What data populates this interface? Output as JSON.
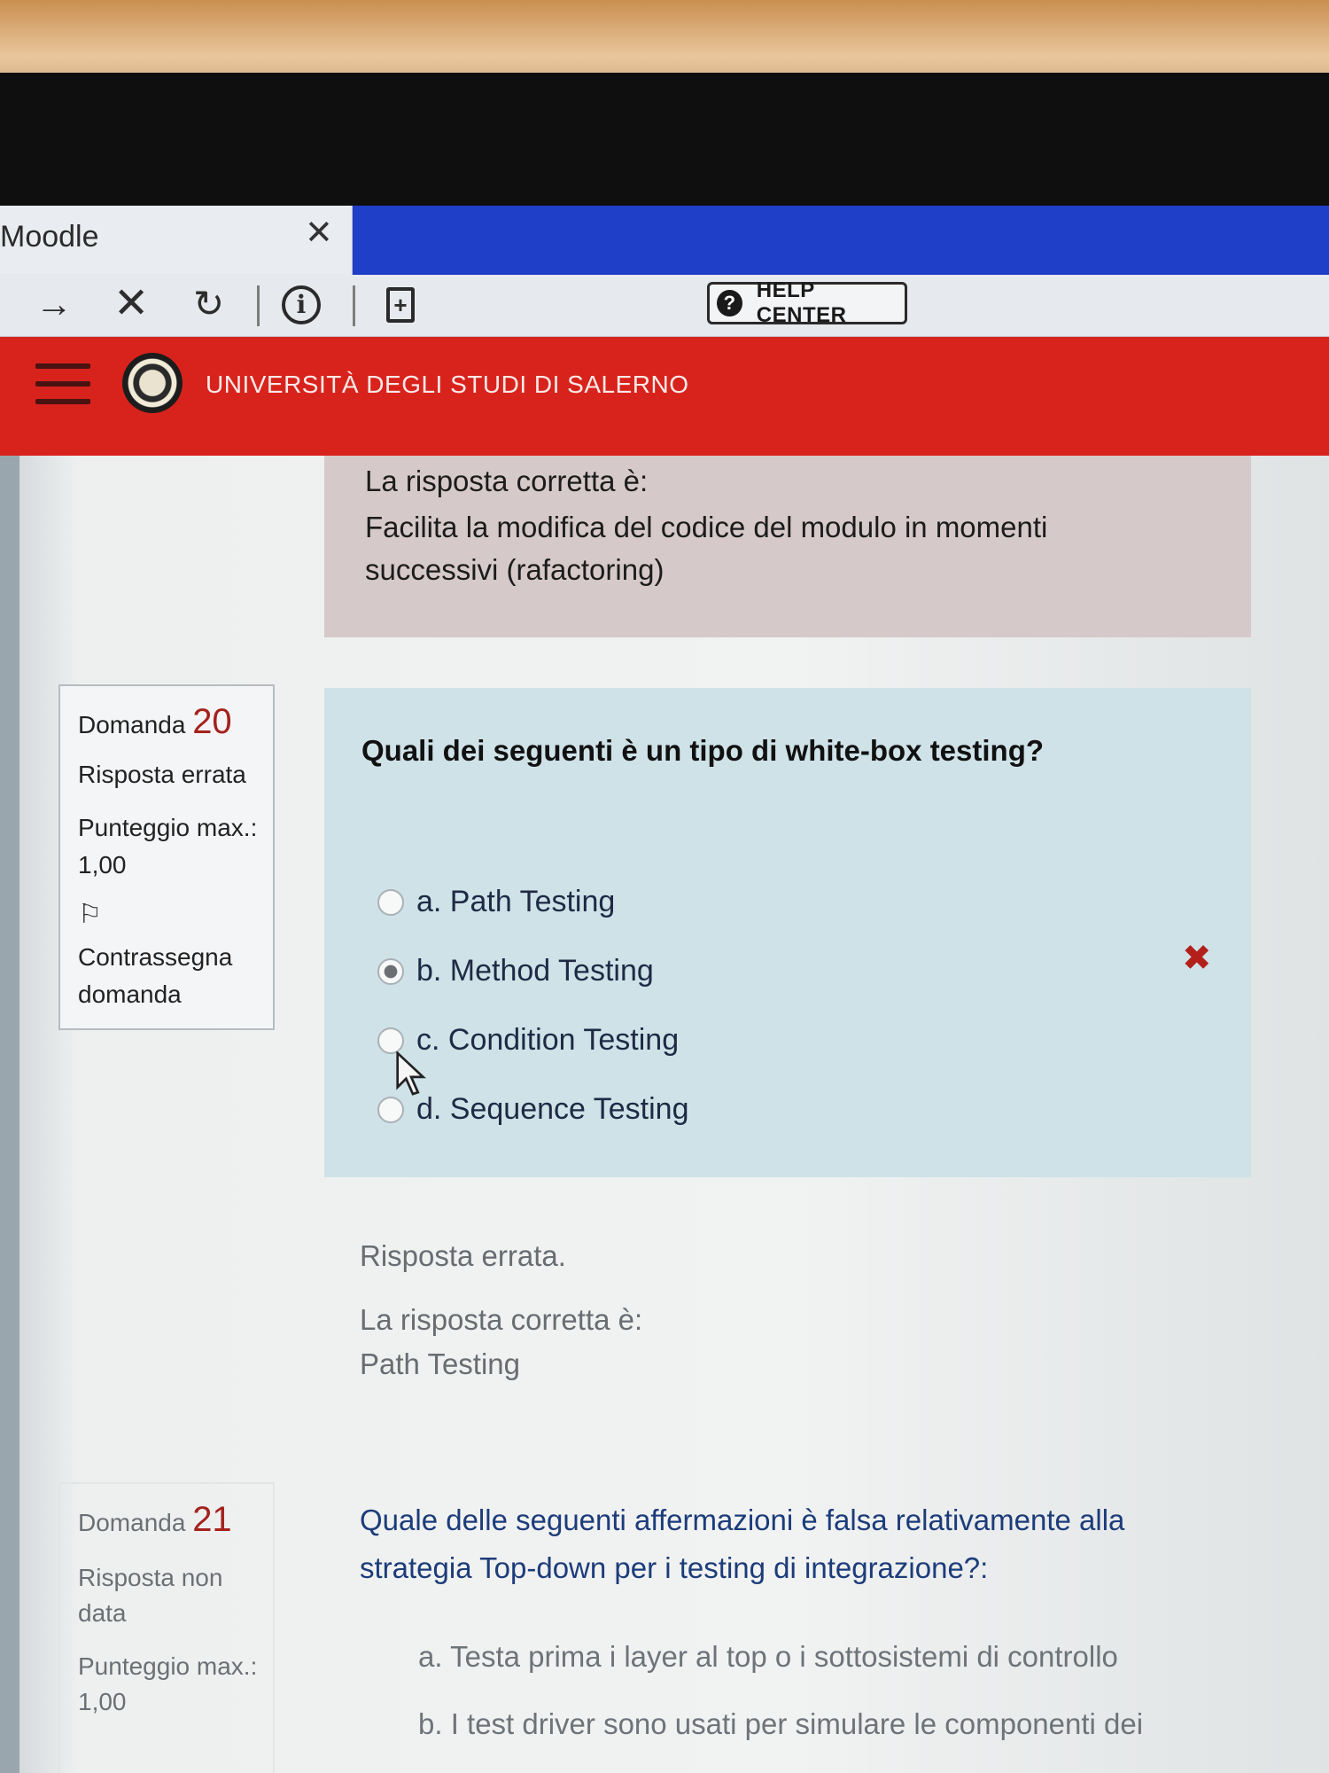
{
  "browser": {
    "tab_title": "Moodle",
    "tab_close": "✕",
    "toolbar": {
      "forward": "→",
      "stop": "✕",
      "reload": "↻",
      "info": "i",
      "page": "+",
      "help_label": "HELP CENTER"
    }
  },
  "header": {
    "university": "UNIVERSITÀ DEGLI STUDI DI SALERNO"
  },
  "prev_feedback": {
    "correct_prefix": "La risposta corretta è:",
    "answer_line1": "Facilita la modifica del codice del modulo in momenti",
    "answer_line2": "successivi (rafactoring)"
  },
  "q20": {
    "label": "Domanda",
    "number": "20",
    "status": "Risposta errata",
    "points_label": "Punteggio max.:",
    "points": "1,00",
    "flag_label_1": "Contrassegna",
    "flag_label_2": "domanda",
    "question": "Quali dei seguenti è un tipo di white-box testing?",
    "options": [
      {
        "label": "a. Path Testing",
        "selected": false
      },
      {
        "label": "b. Method Testing",
        "selected": true
      },
      {
        "label": "c. Condition Testing",
        "selected": false
      },
      {
        "label": "d. Sequence Testing",
        "selected": false
      }
    ],
    "wrong_mark": "✖",
    "feedback": "Risposta errata.",
    "correct_prefix": "La risposta corretta è:",
    "correct_answer": "Path Testing"
  },
  "q21": {
    "label": "Domanda",
    "number": "21",
    "status_1": "Risposta non",
    "status_2": "data",
    "points_label": "Punteggio max.:",
    "points": "1,00",
    "question_line1": "Quale delle seguenti affermazioni è falsa relativamente alla",
    "question_line2": "strategia Top-down per i testing di integrazione?:",
    "options": [
      "a. Testa prima i layer al top o i sottosistemi di controllo",
      "b. I test driver sono usati per simulare le componenti dei"
    ]
  },
  "colors": {
    "header_red": "#d8231d",
    "tab_strip_blue": "#1f3fc9",
    "question_bg": "#cfe2e7",
    "feedback_bg": "#d6c9c9",
    "question_number": "#a4221d",
    "wrong_mark": "#b3201c"
  }
}
